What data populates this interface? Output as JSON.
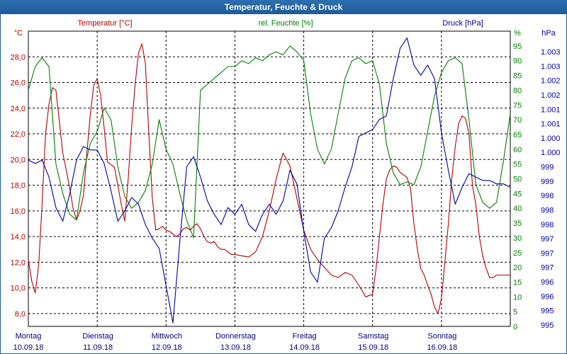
{
  "window": {
    "title": "Temperatur, Feuchte & Druck"
  },
  "chart_data": {
    "type": "line",
    "title": "Temperatur, Feuchte & Druck",
    "grid": true,
    "x_labels": [
      {
        "day": "Montag",
        "date": "10.09.18"
      },
      {
        "day": "Dienstag",
        "date": "11.09.18"
      },
      {
        "day": "Mittwoch",
        "date": "12.09.18"
      },
      {
        "day": "Donnerstag",
        "date": "13.09.18"
      },
      {
        "day": "Freitag",
        "date": "14.09.18"
      },
      {
        "day": "Samstag",
        "date": "15.09.18"
      },
      {
        "day": "Sonntag",
        "date": "16.09.18"
      }
    ],
    "axes": {
      "temp": {
        "unit": "°C",
        "label": "Temperatur [°C]",
        "color": "#b00000",
        "range": [
          7,
          30
        ],
        "ticks": [
          "8,0",
          "10,0",
          "12,0",
          "14,0",
          "16,0",
          "18,0",
          "20,0",
          "22,0",
          "24,0",
          "26,0",
          "28,0"
        ]
      },
      "hum": {
        "unit": "%",
        "label": "rel. Feuchte [%]",
        "color": "#008000",
        "range": [
          0,
          100
        ],
        "ticks": [
          "0",
          "5",
          "10",
          "15",
          "20",
          "25",
          "30",
          "35",
          "40",
          "45",
          "50",
          "55",
          "60",
          "65",
          "70",
          "75",
          "80",
          "85",
          "90",
          "95"
        ]
      },
      "press": {
        "unit": "hPa",
        "label": "Druck [hPa]",
        "color": "#0000a0",
        "range": [
          995,
          1003.7
        ],
        "ticks": [
          "995",
          "995",
          "996",
          "996",
          "997",
          "997",
          "997",
          "998",
          "998",
          "998",
          "999",
          "999",
          "1.000",
          "1.000",
          "1.001",
          "1.001",
          "1.002",
          "1.002",
          "1.003",
          "1.003"
        ]
      }
    },
    "series": [
      {
        "name": "Temperatur [°C]",
        "color": "#b00000",
        "x": [
          0,
          0.05,
          0.1,
          0.15,
          0.2,
          0.25,
          0.3,
          0.35,
          0.4,
          0.45,
          0.5,
          0.55,
          0.6,
          0.65,
          0.7,
          0.75,
          0.8,
          0.85,
          0.9,
          0.95,
          1.0,
          1.05,
          1.1,
          1.15,
          1.2,
          1.25,
          1.3,
          1.35,
          1.4,
          1.45,
          1.5,
          1.55,
          1.6,
          1.65,
          1.7,
          1.75,
          1.8,
          1.85,
          1.9,
          1.95,
          2.0,
          2.05,
          2.1,
          2.15,
          2.2,
          2.25,
          2.3,
          2.35,
          2.4,
          2.45,
          2.5,
          2.55,
          2.6,
          2.65,
          2.7,
          2.75,
          2.8,
          2.85,
          2.9,
          2.95,
          3.0,
          3.1,
          3.2,
          3.3,
          3.4,
          3.5,
          3.6,
          3.7,
          3.8,
          3.9,
          4.0,
          4.1,
          4.2,
          4.3,
          4.4,
          4.5,
          4.6,
          4.7,
          4.8,
          4.9,
          5.0,
          5.05,
          5.1,
          5.15,
          5.2,
          5.25,
          5.3,
          5.35,
          5.4,
          5.45,
          5.5,
          5.55,
          5.6,
          5.65,
          5.7,
          5.75,
          5.8,
          5.85,
          5.9,
          5.95,
          6.0,
          6.05,
          6.1,
          6.15,
          6.2,
          6.25,
          6.3,
          6.35,
          6.4,
          6.45,
          6.5,
          6.55,
          6.6,
          6.65,
          6.7,
          6.75,
          6.8,
          6.85,
          6.9,
          6.95,
          7.0
        ],
        "values": [
          12.2,
          10.5,
          9.6,
          11.8,
          16.5,
          22.0,
          24.3,
          25.6,
          25.4,
          23.0,
          20.5,
          19.2,
          17.8,
          16.2,
          15.3,
          16.0,
          17.2,
          20.5,
          23.5,
          25.8,
          26.3,
          25.0,
          22.5,
          19.8,
          19.6,
          19.4,
          18.0,
          16.5,
          15.2,
          18.5,
          22.5,
          25.8,
          28.3,
          29.0,
          27.5,
          22.0,
          17.0,
          14.5,
          14.6,
          14.8,
          14.5,
          14.4,
          14.2,
          14.0,
          14.2,
          14.6,
          14.7,
          14.5,
          14.8,
          15.0,
          14.6,
          14.0,
          13.6,
          13.5,
          13.6,
          13.2,
          13.0,
          13.0,
          12.8,
          12.6,
          12.6,
          12.5,
          12.4,
          12.8,
          14.0,
          16.0,
          18.5,
          20.5,
          19.5,
          17.0,
          14.5,
          13.0,
          12.2,
          11.6,
          11.0,
          10.8,
          11.2,
          11.0,
          10.2,
          9.3,
          9.5,
          11.5,
          14.0,
          16.5,
          18.5,
          19.2,
          19.5,
          19.4,
          19.0,
          18.8,
          18.6,
          17.8,
          15.0,
          13.0,
          11.5,
          11.0,
          10.2,
          9.5,
          8.5,
          8.0,
          9.2,
          12.0,
          15.0,
          18.5,
          21.0,
          22.8,
          23.4,
          23.2,
          22.0,
          18.0,
          16.5,
          14.0,
          12.5,
          11.5,
          10.8,
          10.8,
          11.0,
          11.0,
          11.0,
          11.0,
          11.0
        ]
      },
      {
        "name": "rel. Feuchte [%]",
        "color": "#008000",
        "x": [
          0,
          0.1,
          0.2,
          0.3,
          0.4,
          0.5,
          0.6,
          0.7,
          0.8,
          0.9,
          1.0,
          1.1,
          1.2,
          1.3,
          1.4,
          1.5,
          1.6,
          1.7,
          1.8,
          1.9,
          2.0,
          2.1,
          2.2,
          2.3,
          2.4,
          2.5,
          2.6,
          2.7,
          2.8,
          2.9,
          3.0,
          3.1,
          3.2,
          3.3,
          3.4,
          3.5,
          3.6,
          3.7,
          3.8,
          3.9,
          4.0,
          4.1,
          4.2,
          4.3,
          4.4,
          4.5,
          4.6,
          4.7,
          4.8,
          4.9,
          5.0,
          5.1,
          5.2,
          5.3,
          5.4,
          5.5,
          5.6,
          5.7,
          5.8,
          5.9,
          6.0,
          6.1,
          6.2,
          6.3,
          6.4,
          6.5,
          6.6,
          6.7,
          6.8,
          6.9,
          7.0
        ],
        "values": [
          80,
          88,
          91,
          88,
          55,
          45,
          38,
          36,
          52,
          62,
          66,
          74,
          70,
          54,
          44,
          40,
          42,
          46,
          55,
          70,
          60,
          55,
          45,
          36,
          30,
          80,
          82,
          84,
          86,
          88,
          88,
          90,
          89,
          91,
          90,
          92,
          93,
          92,
          95,
          93,
          90,
          72,
          60,
          55,
          60,
          72,
          84,
          90,
          91,
          89,
          90,
          82,
          62,
          52,
          48,
          49,
          48,
          54,
          66,
          78,
          86,
          90,
          91,
          89,
          70,
          48,
          42,
          40,
          42,
          56,
          72
        ]
      },
      {
        "name": "Druck [hPa]",
        "color": "#0000a0",
        "x": [
          0,
          0.1,
          0.2,
          0.3,
          0.4,
          0.5,
          0.6,
          0.7,
          0.8,
          0.9,
          1.0,
          1.1,
          1.2,
          1.3,
          1.4,
          1.5,
          1.6,
          1.7,
          1.8,
          1.9,
          2.0,
          2.1,
          2.2,
          2.3,
          2.4,
          2.5,
          2.6,
          2.7,
          2.8,
          2.9,
          3.0,
          3.1,
          3.2,
          3.3,
          3.4,
          3.5,
          3.6,
          3.7,
          3.8,
          3.9,
          4.0,
          4.1,
          4.2,
          4.3,
          4.4,
          4.5,
          4.6,
          4.7,
          4.8,
          4.9,
          5.0,
          5.1,
          5.2,
          5.3,
          5.4,
          5.5,
          5.6,
          5.7,
          5.8,
          5.9,
          6.0,
          6.1,
          6.2,
          6.3,
          6.4,
          6.5,
          6.6,
          6.7,
          6.8,
          6.9,
          7.0
        ],
        "values": [
          999.9,
          999.8,
          999.9,
          999.4,
          998.5,
          998.1,
          998.9,
          999.9,
          1000.3,
          1000.2,
          1000.2,
          999.8,
          999.0,
          998.1,
          998.4,
          998.8,
          998.6,
          998.0,
          997.6,
          997.3,
          996.2,
          995.1,
          997.5,
          999.7,
          1000.0,
          999.4,
          998.7,
          998.3,
          998.0,
          998.5,
          998.3,
          998.6,
          998.0,
          997.8,
          998.3,
          998.6,
          998.3,
          998.7,
          999.6,
          999.2,
          997.8,
          996.6,
          996.3,
          997.6,
          997.9,
          998.4,
          999.1,
          999.7,
          1000.6,
          1000.7,
          1000.8,
          1001.1,
          1001.2,
          1002.3,
          1003.2,
          1003.5,
          1002.7,
          1002.4,
          1002.7,
          1002.3,
          1000.7,
          999.6,
          998.6,
          999.1,
          999.5,
          999.4,
          999.3,
          999.3,
          999.2,
          999.2,
          999.1
        ]
      }
    ]
  }
}
